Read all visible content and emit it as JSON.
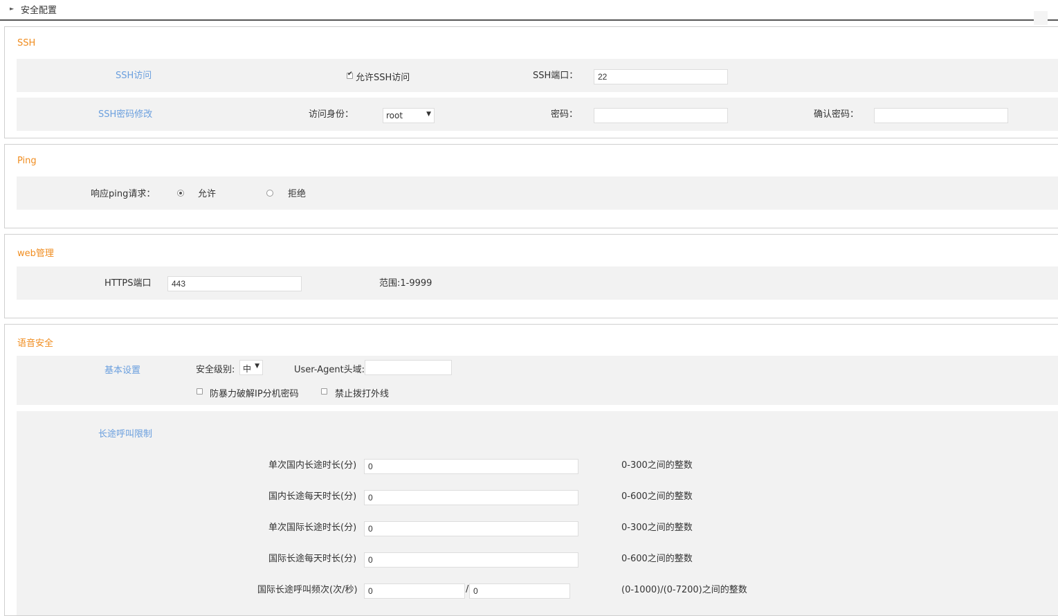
{
  "header": {
    "title": "安全配置"
  },
  "ssh": {
    "title": "SSH",
    "access_label": "SSH访问",
    "allow_ssh_label": "允许SSH访问",
    "allow_ssh_checked": true,
    "port_label": "SSH端口：",
    "port_value": "22",
    "pw_change_label": "SSH密码修改",
    "identity_label": "访问身份：",
    "identity_value": "root",
    "password_label": "密码：",
    "confirm_password_label": "确认密码："
  },
  "ping": {
    "title": "Ping",
    "respond_label": "响应ping请求：",
    "allow_label": "允许",
    "deny_label": "拒绝",
    "selected": "允许"
  },
  "web": {
    "title": "web管理",
    "https_port_label": "HTTPS端口",
    "https_port_value": "443",
    "range_hint": "范围:1-9999"
  },
  "voice": {
    "title": "语音安全",
    "basic_label": "基本设置",
    "security_level_label": "安全级别:",
    "security_level_value": "中",
    "user_agent_label": "User-Agent头域:",
    "user_agent_value": "",
    "anti_bruteforce_label": "防暴力破解IP分机密码",
    "anti_bruteforce_checked": false,
    "no_outside_label": "禁止拨打外线",
    "no_outside_checked": false,
    "ld_limit_label": "长途呼叫限制",
    "ld_rows": [
      {
        "label": "单次国内长途时长(分)",
        "value": "0",
        "hint": "0-300之间的整数"
      },
      {
        "label": "国内长途每天时长(分)",
        "value": "0",
        "hint": "0-600之间的整数"
      },
      {
        "label": "单次国际长途时长(分)",
        "value": "0",
        "hint": "0-300之间的整数"
      },
      {
        "label": "国际长途每天时长(分)",
        "value": "0",
        "hint": "0-600之间的整数"
      }
    ],
    "freq_label": "国际长途呼叫频次(次/秒)",
    "freq_value1": "0",
    "freq_sep": "/",
    "freq_value2": "0",
    "freq_hint": "(0-1000)/(0-7200)之间的整数"
  }
}
